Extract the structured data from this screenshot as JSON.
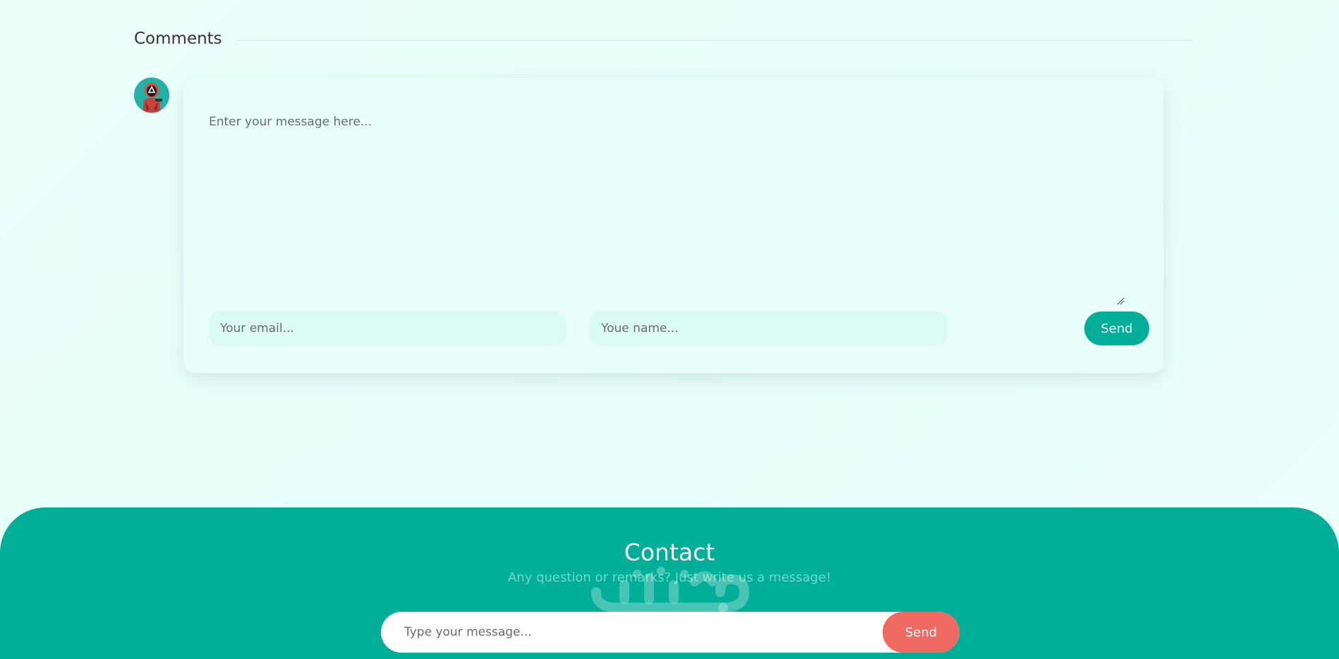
{
  "comments": {
    "title": "Comments",
    "message_placeholder": "Enter your message here...",
    "email_placeholder": "Your email...",
    "name_placeholder": "Youe name...",
    "send_label": "Send"
  },
  "avatar": {
    "icon": "squid-game-guard-avatar-icon"
  },
  "contact": {
    "title": "Contact",
    "subtitle": "Any question or remarks? Just write us a message!",
    "message_placeholder": "Type your message...",
    "send_label": "Send"
  },
  "watermark": {
    "logo": "mostaql-logo",
    "text": "mostaql.com"
  },
  "colors": {
    "page_bg": "#e9fffb",
    "accent": "#01ae97",
    "field_bg": "#dbfaf4",
    "contact_send": "#f06a63"
  }
}
